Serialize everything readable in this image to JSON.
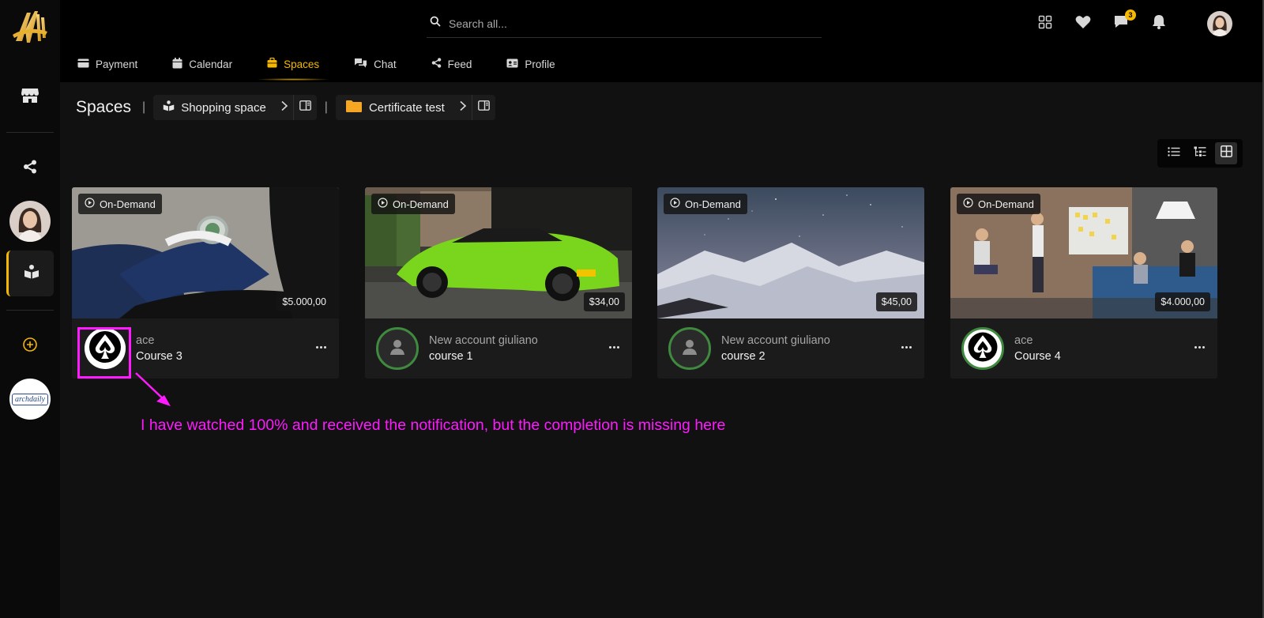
{
  "header": {
    "search_placeholder": "Search all...",
    "message_count": "3",
    "icons": [
      "apps-grid-icon",
      "heart-icon",
      "chat-bubble-icon",
      "bell-icon"
    ]
  },
  "nav": {
    "items": [
      {
        "label": "Payment",
        "icon": "credit-card-icon"
      },
      {
        "label": "Calendar",
        "icon": "calendar-icon"
      },
      {
        "label": "Spaces",
        "icon": "briefcase-icon",
        "active": true
      },
      {
        "label": "Chat",
        "icon": "chat-icon"
      },
      {
        "label": "Feed",
        "icon": "share-icon"
      },
      {
        "label": "Profile",
        "icon": "id-card-icon"
      }
    ]
  },
  "sidebar": {
    "items": [
      "store-icon",
      "share-icon",
      "user-avatar",
      "book-icon",
      "plus-circle-icon",
      "archdaily-avatar"
    ],
    "archdaily_label": "archdaily"
  },
  "breadcrumb": {
    "title": "Spaces",
    "separator": "|",
    "items": [
      {
        "label": "Shopping space",
        "icon": "book-icon"
      },
      {
        "label": "Certificate test",
        "icon": "folder-icon"
      }
    ]
  },
  "view_modes": {
    "options": [
      "list",
      "tree",
      "grid"
    ],
    "active": "grid"
  },
  "cards": [
    {
      "badge": "On-Demand",
      "price": "$5.000,00",
      "owner": "ace",
      "title": "Course 3"
    },
    {
      "badge": "On-Demand",
      "price": "$34,00",
      "owner": "New account giuliano",
      "title": "course 1"
    },
    {
      "badge": "On-Demand",
      "price": "$45,00",
      "owner": "New account giuliano",
      "title": "course 2"
    },
    {
      "badge": "On-Demand",
      "price": "$4.000,00",
      "owner": "ace",
      "title": "Course 4"
    }
  ],
  "annotation": {
    "note": "I have watched 100% and received the notification, but the completion is missing here",
    "color": "#ff1aff"
  },
  "colors": {
    "accent": "#f5b800",
    "avatar_ring": "#3f8a3f",
    "background": "#111111"
  }
}
